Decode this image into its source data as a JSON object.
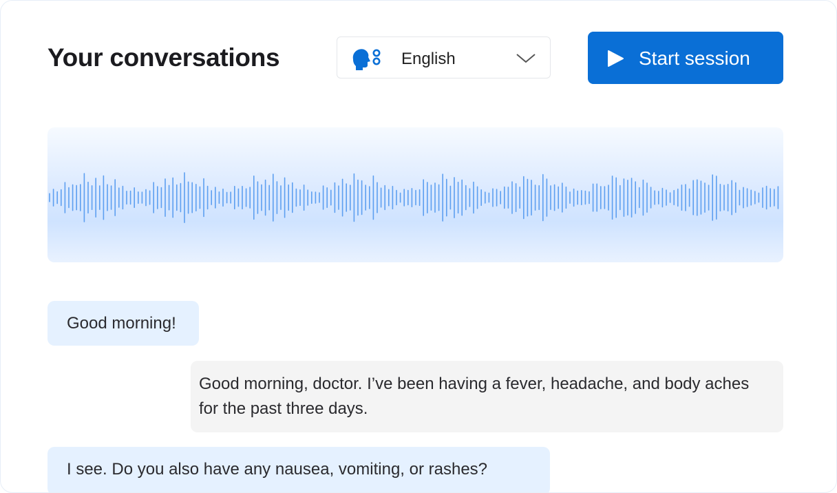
{
  "header": {
    "title": "Your conversations",
    "language": {
      "selected": "English",
      "icon": "speaking-head-icon"
    },
    "start_button": {
      "label": "Start session",
      "icon": "play-icon"
    }
  },
  "waveform": {
    "color": "#5d9ff0",
    "background": "#dceaff"
  },
  "messages": [
    {
      "speaker": "doctor",
      "text": "Good morning!"
    },
    {
      "speaker": "patient",
      "text": "Good morning, doctor. I’ve been having a fever, headache, and body aches for the past three days."
    },
    {
      "speaker": "doctor",
      "text": "I see. Do you also have any nausea, vomiting, or rashes?"
    }
  ],
  "colors": {
    "accent": "#0a6fd6",
    "doctor_bubble": "#e5f1ff",
    "patient_bubble": "#f4f4f4"
  }
}
